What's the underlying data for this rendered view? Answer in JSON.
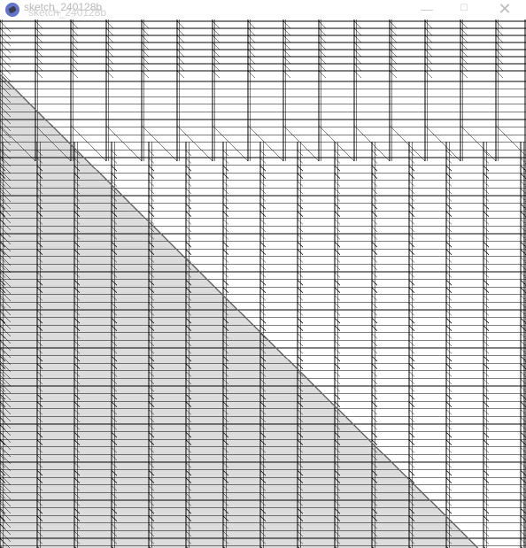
{
  "window": {
    "title": "sketch_240128b",
    "title_echo": "sketch_240128b",
    "minimize_glyph": "—",
    "maximize_glyph": "☐",
    "close_glyph": "✕"
  },
  "icons": {
    "app": "processing-app-icon"
  },
  "colors": {
    "background": "#ffffff",
    "grid_line": "#000000",
    "shaded_fill": "#dcdcdc",
    "diagonal": "#666666"
  }
}
